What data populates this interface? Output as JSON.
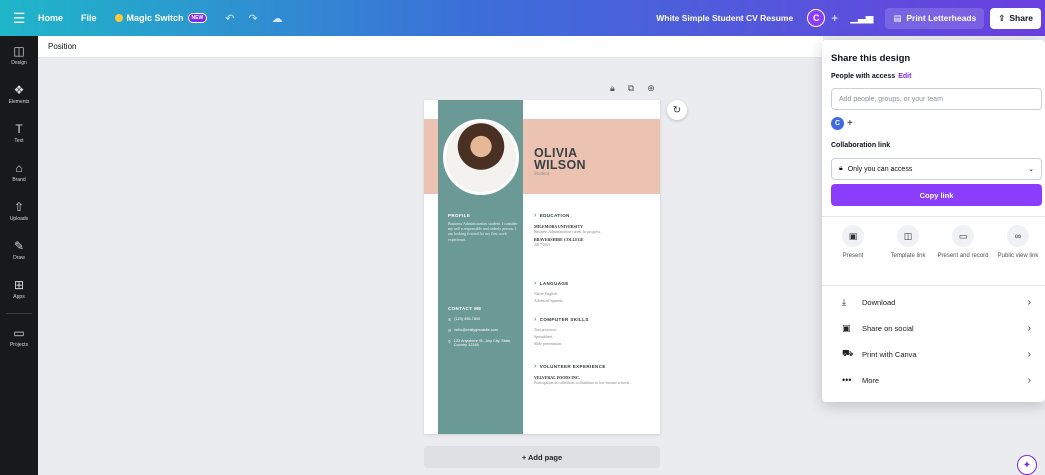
{
  "topbar": {
    "home": "Home",
    "file": "File",
    "magic_switch": "Magic Switch",
    "new_badge": "NEW",
    "doc_title": "White Simple Student CV Resume",
    "avatar_initial": "C",
    "print_letterheads": "Print Letterheads",
    "share": "Share"
  },
  "sidebar": {
    "items": [
      {
        "label": "Design",
        "icon": "layout-icon"
      },
      {
        "label": "Elements",
        "icon": "shapes-icon"
      },
      {
        "label": "Text",
        "icon": "text-icon"
      },
      {
        "label": "Brand",
        "icon": "brand-icon"
      },
      {
        "label": "Uploads",
        "icon": "upload-icon"
      },
      {
        "label": "Draw",
        "icon": "draw-icon"
      },
      {
        "label": "Apps",
        "icon": "apps-icon"
      },
      {
        "label": "Projects",
        "icon": "folder-icon"
      }
    ]
  },
  "toolbar": {
    "position": "Position"
  },
  "resume": {
    "first_name": "OLIVIA",
    "last_name": "WILSON",
    "role": "Student",
    "profile_heading": "PROFILE",
    "profile_text": "Business Administration student. I consider my self a responsible and orderly person. I am looking foward for my first work experience.",
    "contact_heading": "CONTACT ME",
    "phone": "(123) 456-7890",
    "email": "hello@reallygreatsite.com",
    "address": "123 Anywhere St., Any City, State, Country 12345",
    "education_heading": "EDUCATION",
    "edu1_name": "MILEMOBA UNIVERSITY",
    "edu1_text": "Business Administration career. In progress.",
    "edu2_name": "BRAVERSHIRE COLLEGE",
    "edu2_text": "2017-2021",
    "language_heading": "LANGUAGE",
    "lang1": "Native English.",
    "lang2": "Advanced Spanish.",
    "skills_heading": "COMPUTER SKILLS",
    "skill1": "Text processor.",
    "skill2": "Spreadsheet.",
    "skill3": "Slide presentation.",
    "volunteer_heading": "VOLUNTEER EXPERIENCE",
    "vol_name": "VELVERAL FOODS INC.",
    "vol_text": "Participation in collections to distribute to low-income schools."
  },
  "canvas": {
    "add_page": "+ Add page"
  },
  "share_panel": {
    "title": "Share this design",
    "people_with_access": "People with access",
    "edit": "Edit",
    "input_placeholder": "Add people, groups, or your team",
    "avatar_initial": "C",
    "collaboration_link": "Collaboration link",
    "access_value": "Only you can access",
    "copy_link": "Copy link",
    "options": [
      {
        "label": "Present",
        "icon": "present-icon"
      },
      {
        "label": "Template link",
        "icon": "template-icon"
      },
      {
        "label": "Present and record",
        "icon": "record-icon"
      },
      {
        "label": "Public view link",
        "icon": "link-icon"
      }
    ],
    "rows": [
      {
        "label": "Download",
        "icon": "download-icon"
      },
      {
        "label": "Share on social",
        "icon": "social-icon"
      },
      {
        "label": "Print with Canva",
        "icon": "truck-icon"
      },
      {
        "label": "More",
        "icon": "more-icon"
      }
    ]
  }
}
